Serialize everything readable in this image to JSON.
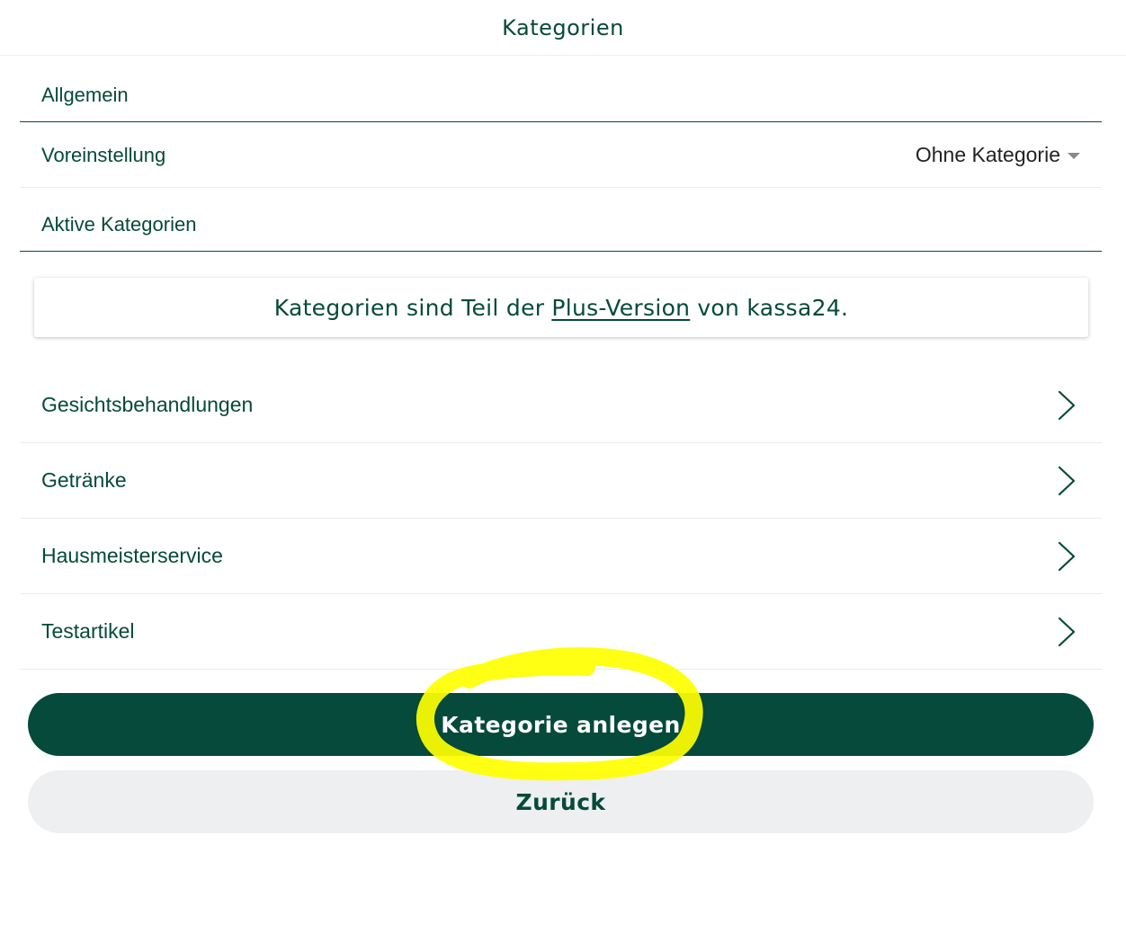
{
  "header": {
    "title": "Kategorien"
  },
  "sections": {
    "general": "Allgemein",
    "active": "Aktive Kategorien"
  },
  "preset": {
    "label": "Voreinstellung",
    "value": "Ohne Kategorie"
  },
  "notice": {
    "before": "Kategorien sind Teil der",
    "link": "Plus-Version",
    "after": "von kassa24."
  },
  "categories": [
    {
      "label": "Gesichtsbehandlungen"
    },
    {
      "label": "Getränke"
    },
    {
      "label": "Hausmeisterservice"
    },
    {
      "label": "Testartikel"
    }
  ],
  "buttons": {
    "create": "Kategorie anlegen",
    "back": "Zurück"
  },
  "colors": {
    "brand": "#054a3a",
    "secondary_button": "#eeeff0",
    "highlight": "#ffff00"
  },
  "icons": {
    "row_arrow": "chevron-right-icon",
    "dropdown": "caret-down-icon"
  }
}
